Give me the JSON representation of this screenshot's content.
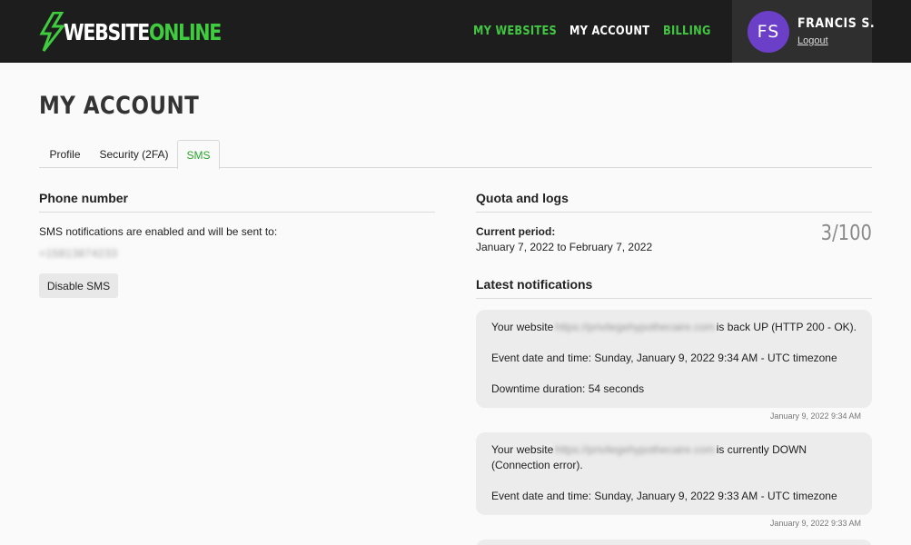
{
  "header": {
    "logo": {
      "part1": "WEBSITE",
      "part2": "ONLINE"
    },
    "nav": [
      {
        "label": "MY WEBSITES"
      },
      {
        "label": "MY ACCOUNT"
      },
      {
        "label": "BILLING"
      }
    ],
    "user": {
      "initials": "FS",
      "name": "FRANCIS S.",
      "logout": "Logout"
    }
  },
  "page": {
    "title": "MY ACCOUNT"
  },
  "tabs": [
    {
      "label": "Profile"
    },
    {
      "label": "Security (2FA)"
    },
    {
      "label": "SMS",
      "active": true
    }
  ],
  "phone": {
    "heading": "Phone number",
    "note": "SMS notifications are enabled and will be sent to:",
    "number": "+15813874233",
    "disable_button": "Disable SMS"
  },
  "quota": {
    "heading": "Quota and logs",
    "period_label": "Current period:",
    "period_range": "January 7, 2022 to February 7, 2022",
    "count": "3/100"
  },
  "notifications": {
    "heading": "Latest notifications",
    "items": [
      {
        "prefix": "Your website",
        "url": "https://privilegehypothecaire.com",
        "suffix": "is back UP (HTTP 200 - OK).",
        "event": "Event date and time: Sunday, January 9, 2022 9:34 AM - UTC timezone",
        "extra": "Downtime duration: 54 seconds",
        "timestamp": "January 9, 2022 9:34 AM"
      },
      {
        "prefix": "Your website",
        "url": "https://privilegehypothecaire.com",
        "suffix": "is currently DOWN (Connection error).",
        "event": "Event date and time: Sunday, January 9, 2022 9:33 AM - UTC timezone",
        "timestamp": "January 9, 2022 9:33 AM"
      }
    ]
  },
  "colors": {
    "brand_green": "#3fcc3f",
    "header_bg": "#1d1d1d",
    "avatar_purple": "#6c3fc8"
  }
}
